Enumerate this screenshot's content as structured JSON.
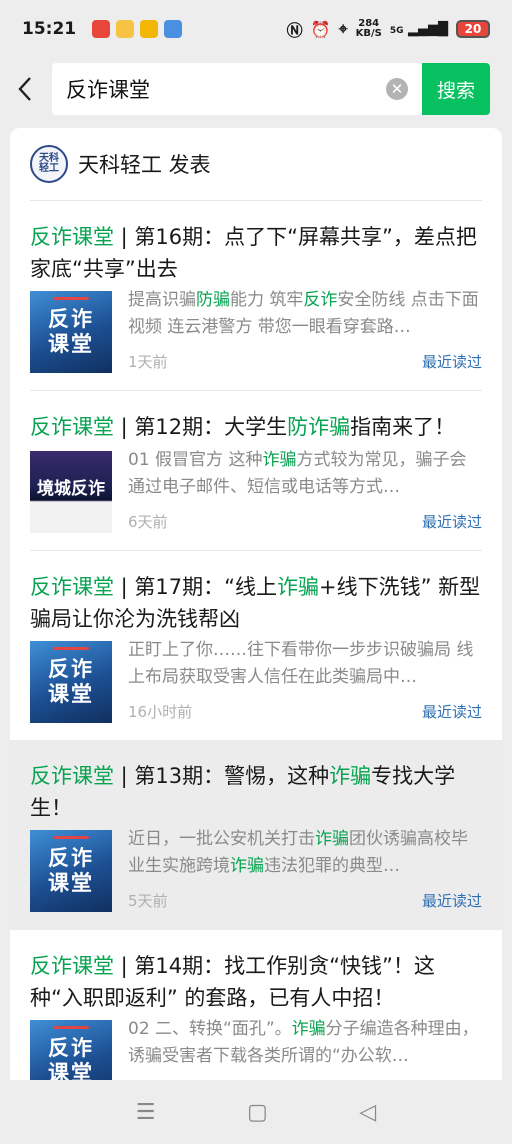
{
  "status_bar": {
    "time": "15:21",
    "net_speed_value": "284",
    "net_speed_unit": "KB/S",
    "signal": "5G",
    "battery": "20"
  },
  "search": {
    "query": "反诈课堂",
    "button_label": "搜索"
  },
  "account": {
    "avatar_text": "天科轻工",
    "name": "天科轻工 发表"
  },
  "articles": [
    {
      "title_keyword": "反诈课堂",
      "title_rest_1": " | 第16期：点了下“屏幕共享”，差点把家底“共享”出去",
      "thumb_text_1": "反诈",
      "thumb_text_2": "课堂",
      "desc_1": "提高识骗",
      "desc_kw_1": "防骗",
      "desc_2": "能力 筑牢",
      "desc_kw_2": "反诈",
      "desc_3": "安全防线 点击下面视频 连云港警方 带您一眼看穿套路…",
      "time": "1天前",
      "read": "最近读过"
    },
    {
      "title_keyword": "反诈课堂",
      "title_rest_1": " | 第12期：大学生",
      "title_kw_2": "防诈骗",
      "title_rest_2": "指南来了！",
      "thumb_text_1": "境城反诈",
      "thumb_text_2": "",
      "desc_1": "01 假冒官方 这种",
      "desc_kw_1": "诈骗",
      "desc_2": "方式较为常见，骗子会通过电子邮件、短信或电话等方式…",
      "time": "6天前",
      "read": "最近读过"
    },
    {
      "title_keyword": "反诈课堂",
      "title_rest_1": " | 第17期：“线上",
      "title_kw_2": "诈骗",
      "title_rest_2": "+线下洗钱” 新型骗局让你沦为洗钱帮凶",
      "thumb_text_1": "反诈",
      "thumb_text_2": "课堂",
      "desc_1": "正盯上了你……往下看带你一步步识破骗局 线上布局获取受害人信任在此类骗局中…",
      "time": "16小时前",
      "read": "最近读过"
    },
    {
      "title_keyword": "反诈课堂",
      "title_rest_1": " | 第13期：警惕，这种",
      "title_kw_2": "诈骗",
      "title_rest_2": "专找大学生！",
      "thumb_text_1": "反诈",
      "thumb_text_2": "课堂",
      "desc_1": "近日，一批公安机关打击",
      "desc_kw_1": "诈骗",
      "desc_2": "团伙诱骗高校毕业生实施跨境",
      "desc_kw_2": "诈骗",
      "desc_3": "违法犯罪的典型…",
      "time": "5天前",
      "read": "最近读过"
    },
    {
      "title_keyword": "反诈课堂",
      "title_rest_1": " | 第14期：找工作别贪“快钱”！这种“入职即返利” 的套路，已有人中招！",
      "thumb_text_1": "反诈",
      "thumb_text_2": "课堂",
      "desc_1": "02 二、转换“面孔”。",
      "desc_kw_1": "诈骗",
      "desc_2": "分子编造各种理由，诱骗受害者下载各类所谓的“办公软…"
    }
  ],
  "nav": {
    "menu_icon": "menu-icon",
    "home_icon": "home-icon",
    "back_icon": "back-triangle-icon"
  }
}
